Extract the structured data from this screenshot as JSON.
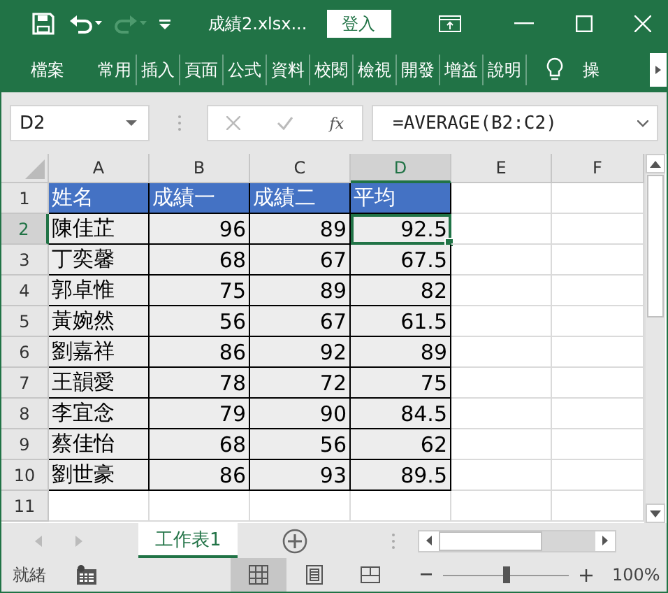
{
  "title_bar": {
    "title": "成績2.xlsx...",
    "sign_in": "登入"
  },
  "ribbon_tabs": [
    {
      "label": "檔案",
      "selected": false
    },
    {
      "label": "常用",
      "selected": false
    },
    {
      "label": "插入",
      "selected": false
    },
    {
      "label": "頁面",
      "selected": false
    },
    {
      "label": "公式",
      "selected": false
    },
    {
      "label": "資料",
      "selected": false
    },
    {
      "label": "校閱",
      "selected": false
    },
    {
      "label": "檢視",
      "selected": false
    },
    {
      "label": "開發",
      "selected": false
    },
    {
      "label": "增益",
      "selected": false
    },
    {
      "label": "說明",
      "selected": false
    }
  ],
  "tell_me": "操",
  "formula_bar": {
    "name_box": "D2",
    "fx": "fx",
    "formula": "=AVERAGE(B2:C2)"
  },
  "columns": [
    {
      "label": "A",
      "selected": false
    },
    {
      "label": "B",
      "selected": false
    },
    {
      "label": "C",
      "selected": false
    },
    {
      "label": "D",
      "selected": true
    },
    {
      "label": "E",
      "selected": false
    },
    {
      "label": "F",
      "selected": false
    }
  ],
  "rows": [
    {
      "number": "1",
      "selected": false,
      "kind": "header",
      "cells": [
        "姓名",
        "成績一",
        "成績二",
        "平均"
      ]
    },
    {
      "number": "2",
      "selected": true,
      "kind": "data",
      "cells": [
        "陳佳芷",
        "96",
        "89",
        "92.5"
      ]
    },
    {
      "number": "3",
      "selected": false,
      "kind": "data",
      "cells": [
        "丁奕馨",
        "68",
        "67",
        "67.5"
      ]
    },
    {
      "number": "4",
      "selected": false,
      "kind": "data",
      "cells": [
        "郭卓惟",
        "75",
        "89",
        "82"
      ]
    },
    {
      "number": "5",
      "selected": false,
      "kind": "data",
      "cells": [
        "黃婉然",
        "56",
        "67",
        "61.5"
      ]
    },
    {
      "number": "6",
      "selected": false,
      "kind": "data",
      "cells": [
        "劉嘉祥",
        "86",
        "92",
        "89"
      ]
    },
    {
      "number": "7",
      "selected": false,
      "kind": "data",
      "cells": [
        "王韻愛",
        "78",
        "72",
        "75"
      ]
    },
    {
      "number": "8",
      "selected": false,
      "kind": "data",
      "cells": [
        "李宜念",
        "79",
        "90",
        "84.5"
      ]
    },
    {
      "number": "9",
      "selected": false,
      "kind": "data",
      "cells": [
        "蔡佳怡",
        "68",
        "56",
        "62"
      ]
    },
    {
      "number": "10",
      "selected": false,
      "kind": "data",
      "cells": [
        "劉世豪",
        "86",
        "93",
        "89.5"
      ]
    },
    {
      "number": "11",
      "selected": false,
      "kind": "empty"
    }
  ],
  "sheet_tabs": [
    {
      "label": "工作表1",
      "selected": true
    }
  ],
  "status_bar": {
    "status": "就緒",
    "views": [
      {
        "kind": "normal",
        "selected": true
      },
      {
        "kind": "page_layout",
        "selected": false
      },
      {
        "kind": "page_break",
        "selected": false
      }
    ],
    "zoom_slider": {
      "level": 0.5
    },
    "zoom": "100%"
  }
}
